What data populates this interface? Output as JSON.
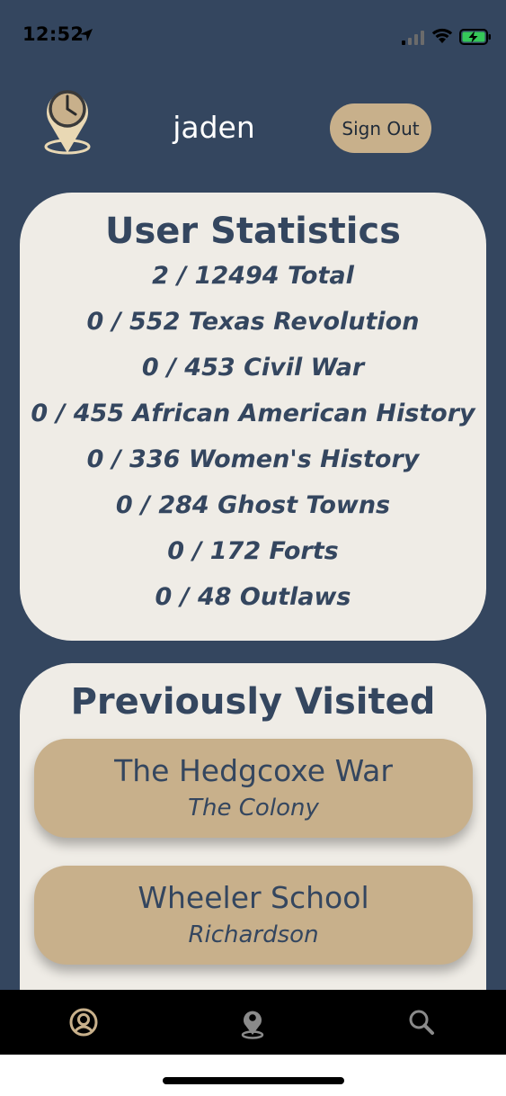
{
  "status_bar": {
    "time": "12:52"
  },
  "header": {
    "username": "jaden",
    "sign_out_label": "Sign Out",
    "logo_icon": "clock-location-pin-icon"
  },
  "stats": {
    "title": "User Statistics",
    "lines": [
      "2 / 12494 Total",
      "0 / 552 Texas Revolution",
      "0 / 453 Civil War",
      "0 / 455 African American History",
      "0 / 336 Women's History",
      "0 / 284 Ghost Towns",
      "0 / 172 Forts",
      "0 / 48 Outlaws"
    ]
  },
  "visited": {
    "title": "Previously Visited",
    "items": [
      {
        "name": "The Hedgcoxe War",
        "city": "The Colony"
      },
      {
        "name": "Wheeler School",
        "city": "Richardson"
      }
    ]
  },
  "tabs": [
    {
      "icon": "user-circle-icon",
      "active": true
    },
    {
      "icon": "map-pin-icon",
      "active": false
    },
    {
      "icon": "search-icon",
      "active": false
    }
  ],
  "colors": {
    "background": "#34465f",
    "card": "#efece6",
    "accent": "#c8b08b",
    "text": "#34465f",
    "tab_active": "#c8b08b",
    "tab_inactive": "#8a8a8a"
  }
}
